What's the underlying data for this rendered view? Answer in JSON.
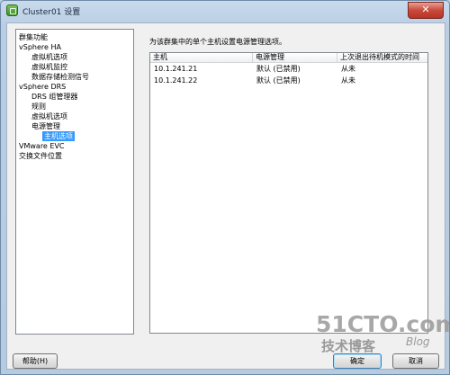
{
  "window": {
    "title": "Cluster01 设置",
    "close_glyph": "✕"
  },
  "nav": {
    "items": [
      {
        "label": "群集功能",
        "level": 0,
        "selected": false
      },
      {
        "label": "vSphere HA",
        "level": 0,
        "selected": false
      },
      {
        "label": "虚拟机选项",
        "level": 1,
        "selected": false
      },
      {
        "label": "虚拟机监控",
        "level": 1,
        "selected": false
      },
      {
        "label": "数据存储检测信号",
        "level": 1,
        "selected": false
      },
      {
        "label": "vSphere DRS",
        "level": 0,
        "selected": false
      },
      {
        "label": "DRS 组管理器",
        "level": 1,
        "selected": false
      },
      {
        "label": "规则",
        "level": 1,
        "selected": false
      },
      {
        "label": "虚拟机选项",
        "level": 1,
        "selected": false
      },
      {
        "label": "电源管理",
        "level": 1,
        "selected": false
      },
      {
        "label": "主机选项",
        "level": 2,
        "selected": true
      },
      {
        "label": "VMware EVC",
        "level": 0,
        "selected": false
      },
      {
        "label": "交换文件位置",
        "level": 0,
        "selected": false
      }
    ]
  },
  "main": {
    "instruction": "为该群集中的单个主机设置电源管理选项。",
    "table": {
      "columns": [
        "主机",
        "电源管理",
        "上次退出待机模式的时间"
      ],
      "rows": [
        [
          "10.1.241.21",
          "默认 (已禁用)",
          "从未"
        ],
        [
          "10.1.241.22",
          "默认 (已禁用)",
          "从未"
        ]
      ]
    }
  },
  "footer": {
    "help_label": "帮助(H)",
    "ok_label": "确定",
    "cancel_label": "取消"
  },
  "watermark": {
    "big": "51CTO.com",
    "small": "技术博客",
    "blog": "Blog"
  },
  "colors": {
    "selection": "#3399ff",
    "title_bar": "#c9daec",
    "close_button": "#c9493a"
  }
}
